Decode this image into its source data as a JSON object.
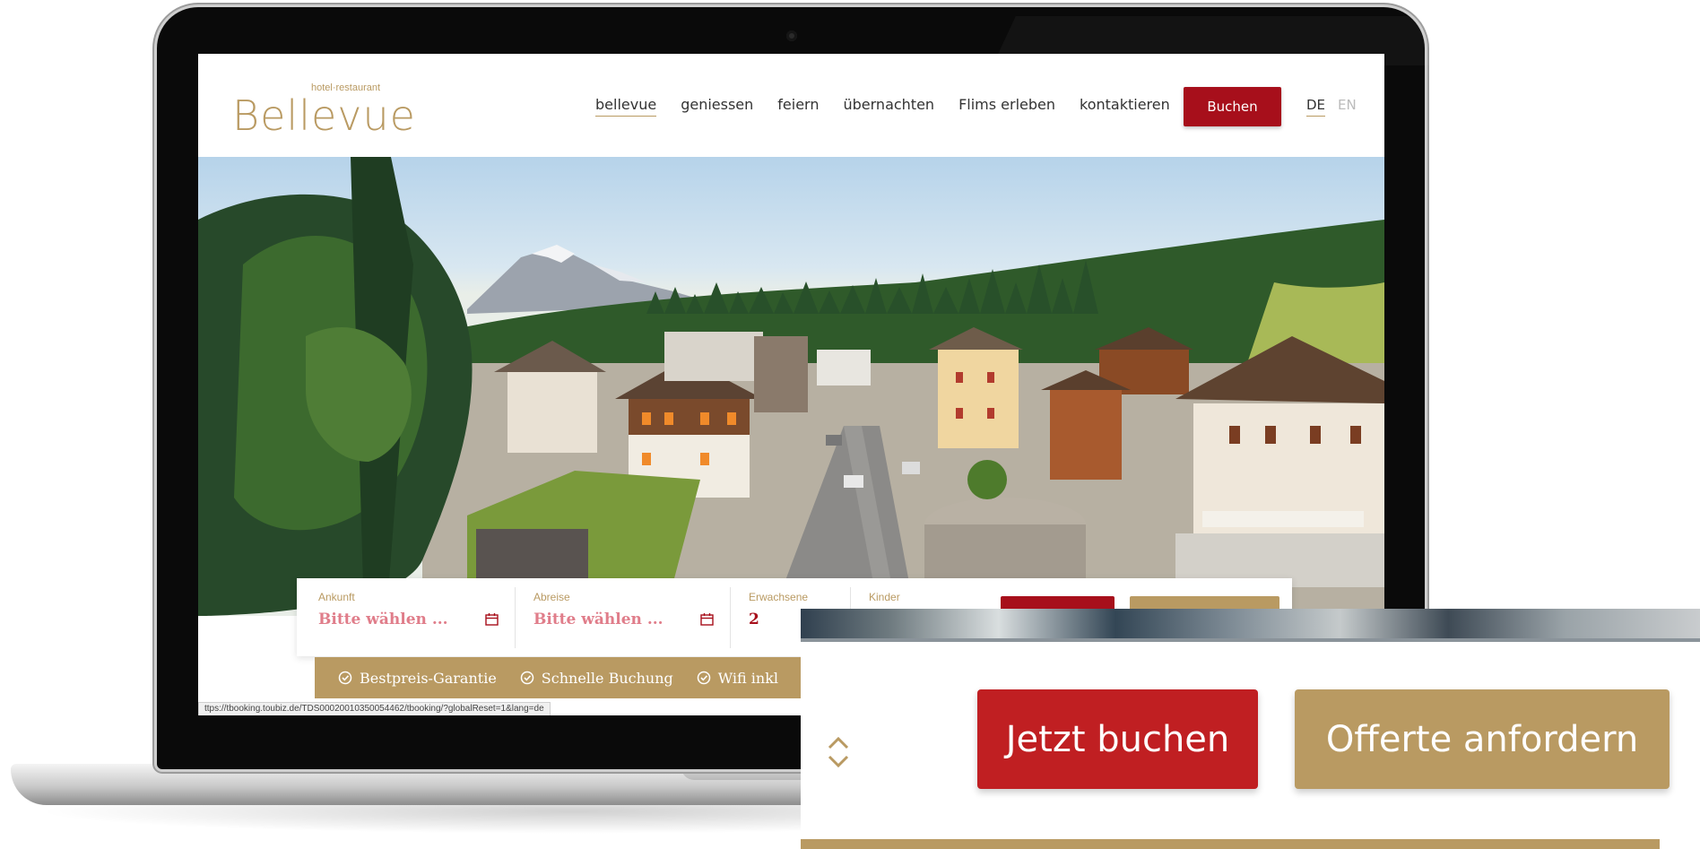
{
  "site": {
    "logo_tagline": "hotel·restaurant",
    "logo_name": "Bellevue",
    "nav": [
      {
        "label": "bellevue",
        "active": true
      },
      {
        "label": "geniessen",
        "active": false
      },
      {
        "label": "feiern",
        "active": false
      },
      {
        "label": "übernachten",
        "active": false
      },
      {
        "label": "Flims erleben",
        "active": false
      },
      {
        "label": "kontaktieren",
        "active": false
      }
    ],
    "book_button": "Buchen",
    "languages": {
      "de": "DE",
      "en": "EN"
    }
  },
  "booking": {
    "arrival_label": "Ankunft",
    "arrival_value": "Bitte wählen ...",
    "departure_label": "Abreise",
    "departure_value": "Bitte wählen ...",
    "adults_label": "Erwachsene",
    "adults_value": "2",
    "children_label": "Kinder"
  },
  "usp": [
    "Bestpreis-Garantie",
    "Schnelle Buchung",
    "Wifi inkl"
  ],
  "status_url": "ttps://tbooking.toubiz.de/TDS00020010350054462/tbooking/?globalReset=1&lang=de",
  "zoom": {
    "book_now": "Jetzt buchen",
    "request_offer": "Offerte anfordern"
  },
  "colors": {
    "brand_red": "#a70f1b",
    "brand_gold": "#b99a62",
    "zoom_red": "#c01f22"
  }
}
